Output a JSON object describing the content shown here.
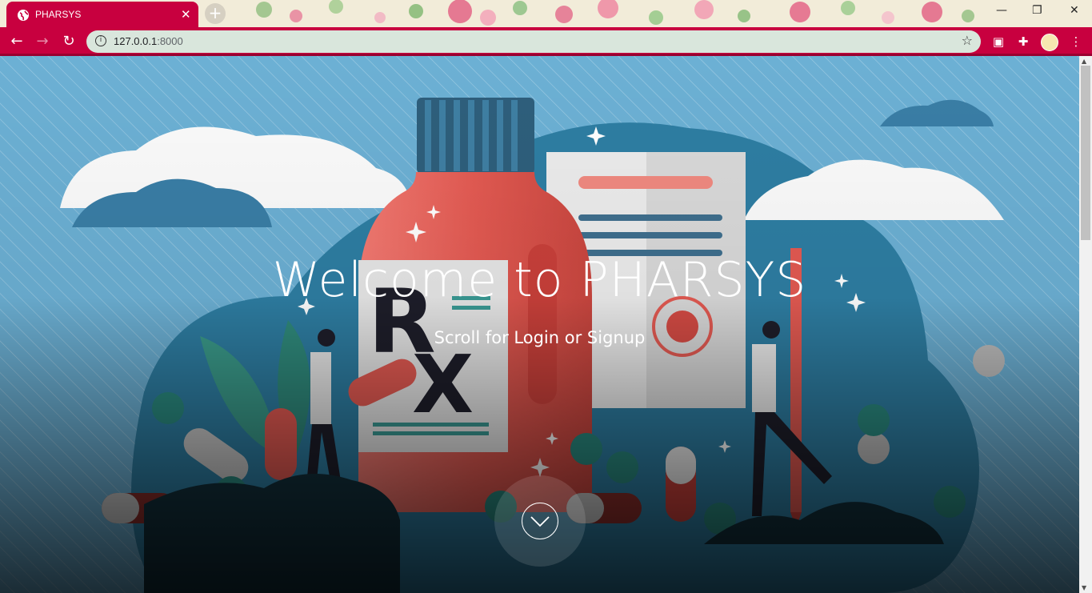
{
  "browser": {
    "tab_title": "PHARSYS",
    "tab_close": "✕",
    "new_tab": "+",
    "url_host": "127.0.0.1",
    "url_port": ":8000",
    "accent_color": "#c8003f"
  },
  "hero": {
    "title": "Welcome to PHARSYS",
    "subtitle": "Scroll for Login or Signup",
    "scroll_icon": "chevron-down-icon"
  }
}
